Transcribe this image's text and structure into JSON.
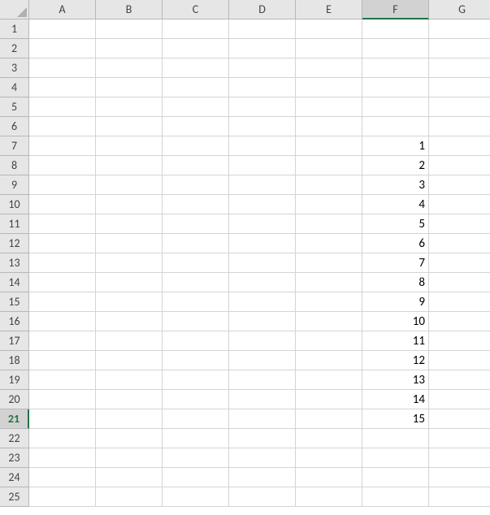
{
  "grid": {
    "columns": [
      "A",
      "B",
      "C",
      "D",
      "E",
      "F",
      "G"
    ],
    "rowCount": 25,
    "selectedColumn": "F",
    "selectedRow": 21,
    "cells": {
      "F7": "1",
      "F8": "2",
      "F9": "3",
      "F10": "4",
      "F11": "5",
      "F12": "6",
      "F13": "7",
      "F14": "8",
      "F15": "9",
      "F16": "10",
      "F17": "11",
      "F18": "12",
      "F19": "13",
      "F20": "14",
      "F21": "15"
    }
  },
  "chart_data": {
    "type": "table",
    "title": "",
    "columns": [
      "A",
      "B",
      "C",
      "D",
      "E",
      "F",
      "G"
    ],
    "rows": [
      {
        "row": 1,
        "A": "",
        "B": "",
        "C": "",
        "D": "",
        "E": "",
        "F": "",
        "G": ""
      },
      {
        "row": 2,
        "A": "",
        "B": "",
        "C": "",
        "D": "",
        "E": "",
        "F": "",
        "G": ""
      },
      {
        "row": 3,
        "A": "",
        "B": "",
        "C": "",
        "D": "",
        "E": "",
        "F": "",
        "G": ""
      },
      {
        "row": 4,
        "A": "",
        "B": "",
        "C": "",
        "D": "",
        "E": "",
        "F": "",
        "G": ""
      },
      {
        "row": 5,
        "A": "",
        "B": "",
        "C": "",
        "D": "",
        "E": "",
        "F": "",
        "G": ""
      },
      {
        "row": 6,
        "A": "",
        "B": "",
        "C": "",
        "D": "",
        "E": "",
        "F": "",
        "G": ""
      },
      {
        "row": 7,
        "A": "",
        "B": "",
        "C": "",
        "D": "",
        "E": "",
        "F": 1,
        "G": ""
      },
      {
        "row": 8,
        "A": "",
        "B": "",
        "C": "",
        "D": "",
        "E": "",
        "F": 2,
        "G": ""
      },
      {
        "row": 9,
        "A": "",
        "B": "",
        "C": "",
        "D": "",
        "E": "",
        "F": 3,
        "G": ""
      },
      {
        "row": 10,
        "A": "",
        "B": "",
        "C": "",
        "D": "",
        "E": "",
        "F": 4,
        "G": ""
      },
      {
        "row": 11,
        "A": "",
        "B": "",
        "C": "",
        "D": "",
        "E": "",
        "F": 5,
        "G": ""
      },
      {
        "row": 12,
        "A": "",
        "B": "",
        "C": "",
        "D": "",
        "E": "",
        "F": 6,
        "G": ""
      },
      {
        "row": 13,
        "A": "",
        "B": "",
        "C": "",
        "D": "",
        "E": "",
        "F": 7,
        "G": ""
      },
      {
        "row": 14,
        "A": "",
        "B": "",
        "C": "",
        "D": "",
        "E": "",
        "F": 8,
        "G": ""
      },
      {
        "row": 15,
        "A": "",
        "B": "",
        "C": "",
        "D": "",
        "E": "",
        "F": 9,
        "G": ""
      },
      {
        "row": 16,
        "A": "",
        "B": "",
        "C": "",
        "D": "",
        "E": "",
        "F": 10,
        "G": ""
      },
      {
        "row": 17,
        "A": "",
        "B": "",
        "C": "",
        "D": "",
        "E": "",
        "F": 11,
        "G": ""
      },
      {
        "row": 18,
        "A": "",
        "B": "",
        "C": "",
        "D": "",
        "E": "",
        "F": 12,
        "G": ""
      },
      {
        "row": 19,
        "A": "",
        "B": "",
        "C": "",
        "D": "",
        "E": "",
        "F": 13,
        "G": ""
      },
      {
        "row": 20,
        "A": "",
        "B": "",
        "C": "",
        "D": "",
        "E": "",
        "F": 14,
        "G": ""
      },
      {
        "row": 21,
        "A": "",
        "B": "",
        "C": "",
        "D": "",
        "E": "",
        "F": 15,
        "G": ""
      },
      {
        "row": 22,
        "A": "",
        "B": "",
        "C": "",
        "D": "",
        "E": "",
        "F": "",
        "G": ""
      },
      {
        "row": 23,
        "A": "",
        "B": "",
        "C": "",
        "D": "",
        "E": "",
        "F": "",
        "G": ""
      },
      {
        "row": 24,
        "A": "",
        "B": "",
        "C": "",
        "D": "",
        "E": "",
        "F": "",
        "G": ""
      },
      {
        "row": 25,
        "A": "",
        "B": "",
        "C": "",
        "D": "",
        "E": "",
        "F": "",
        "G": ""
      }
    ]
  }
}
